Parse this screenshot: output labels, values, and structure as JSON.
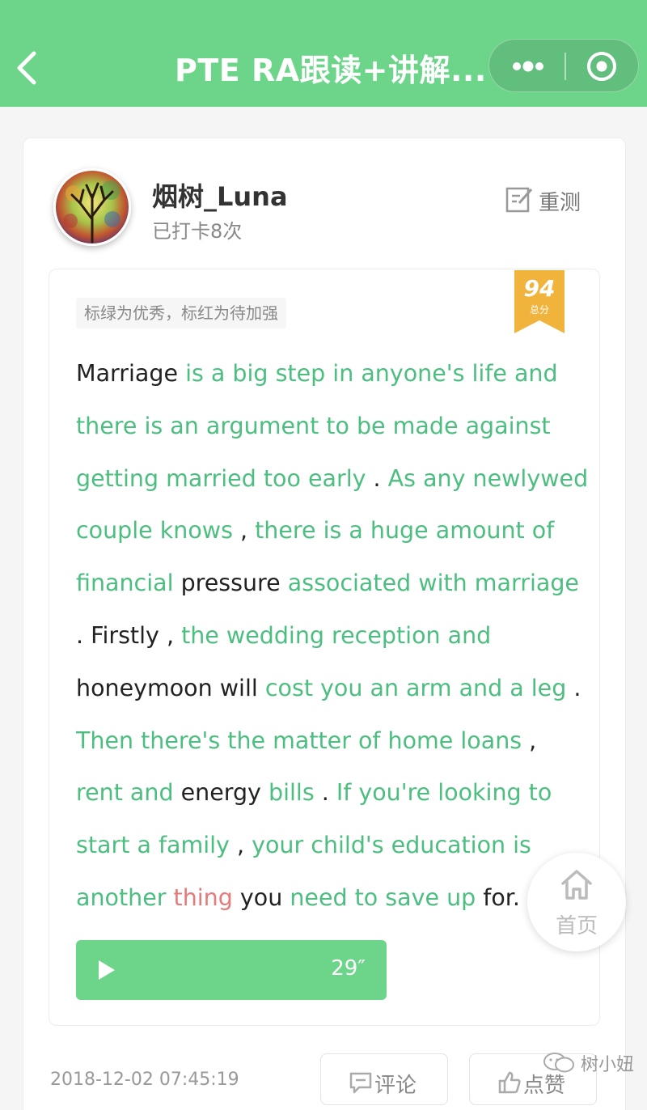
{
  "navbar": {
    "title": "PTE RA跟读+讲解...",
    "bg_color": "#6cd58a",
    "back_icon": "chevron-left-icon",
    "more_icon": "more-dots-icon",
    "close_icon": "target-circle-icon"
  },
  "user": {
    "name": "烟树_Luna",
    "checkin": "已打卡8次",
    "avatar_icon": "tree-avatar"
  },
  "retest": {
    "label": "重测",
    "icon": "edit-icon"
  },
  "hint": "标绿为优秀，标红为待加强",
  "score": {
    "value": "94",
    "label": "总分",
    "color": "#f0b33c"
  },
  "colors": {
    "good": "#4cbe80",
    "normal": "#222222",
    "bad": "#e47a7a"
  },
  "passage": [
    [
      [
        "normal",
        "Marriage"
      ],
      [
        "normal",
        " "
      ],
      [
        "good",
        "is a big step in anyone's life and"
      ]
    ],
    [
      [
        "good",
        "there is an argument to be made against"
      ]
    ],
    [
      [
        "good",
        "getting married too early"
      ],
      [
        "normal",
        " . "
      ],
      [
        "good",
        "As any newlywed"
      ]
    ],
    [
      [
        "good",
        "couple knows"
      ],
      [
        "normal",
        " , "
      ],
      [
        "good",
        "there is a huge amount of"
      ]
    ],
    [
      [
        "good",
        "financial"
      ],
      [
        "normal",
        " pressure "
      ],
      [
        "good",
        "associated with marriage"
      ]
    ],
    [
      [
        "normal",
        ". Firstly , "
      ],
      [
        "good",
        "the wedding reception and"
      ]
    ],
    [
      [
        "normal",
        "honeymoon will "
      ],
      [
        "good",
        "cost you an arm and a leg"
      ],
      [
        "normal",
        " ."
      ]
    ],
    [
      [
        "good",
        "Then there's the matter of home loans"
      ],
      [
        "normal",
        " ,"
      ]
    ],
    [
      [
        "good",
        "rent and"
      ],
      [
        "normal",
        " energy "
      ],
      [
        "good",
        "bills"
      ],
      [
        "normal",
        " . "
      ],
      [
        "good",
        "If you're looking to"
      ]
    ],
    [
      [
        "good",
        "start a family"
      ],
      [
        "normal",
        " , "
      ],
      [
        "good",
        "your child's education is"
      ]
    ],
    [
      [
        "good",
        "another"
      ],
      [
        "normal",
        " "
      ],
      [
        "bad",
        "thing"
      ],
      [
        "normal",
        " you "
      ],
      [
        "good",
        "need to save up"
      ],
      [
        "normal",
        " for."
      ]
    ]
  ],
  "audio": {
    "duration": "29″",
    "icon": "play-icon"
  },
  "home_button": {
    "label": "首页",
    "icon": "home-icon"
  },
  "timestamp": "2018-12-02 07:45:19",
  "actions": {
    "comment": "评论",
    "like": "点赞"
  },
  "watermark": "树小妞"
}
